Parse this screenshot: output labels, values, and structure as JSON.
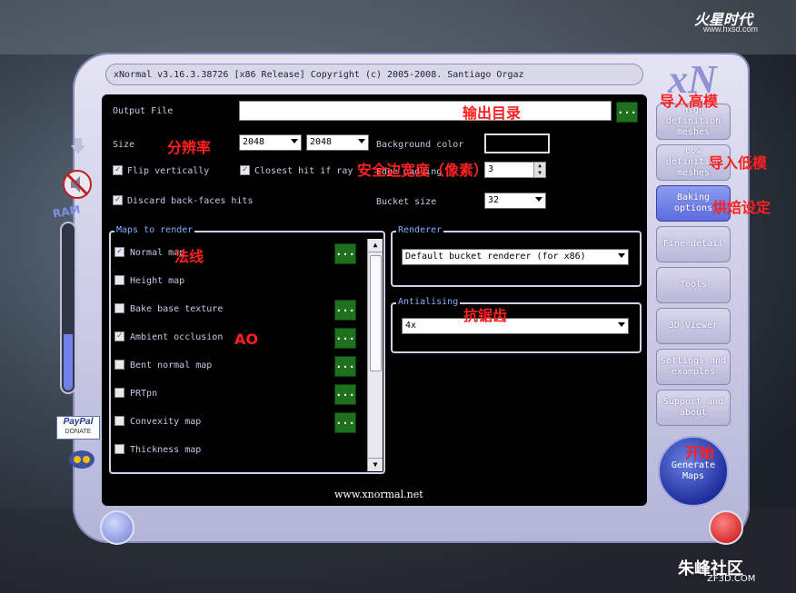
{
  "branding": {
    "logo": "火星时代",
    "url": "www.hxsd.com",
    "watermark_cn": "朱峰社区",
    "watermark_url": "ZF3D.COM"
  },
  "window": {
    "title": "xNormal v3.16.3.38726 [x86 Release] Copyright (c) 2005-2008. Santiago Orgaz",
    "logo": "xN"
  },
  "ram_label": "RAM",
  "ram_level": 0.33,
  "paypal": {
    "line1": "PayPal",
    "line2": "DONATE"
  },
  "output": {
    "label": "Output File",
    "value": "",
    "browse": "..."
  },
  "size": {
    "label": "Size",
    "width": "2048",
    "height": "2048"
  },
  "background_color": {
    "label": "Background color",
    "color": "#000000"
  },
  "flip_vertically": {
    "label": "Flip vertically",
    "checked": true
  },
  "closest_hit": {
    "label": "Closest hit if ray fails",
    "checked": true
  },
  "edge_padding": {
    "label": "Edge padding",
    "value": "3"
  },
  "discard_backfaces": {
    "label": "Discard back-faces hits",
    "checked": true
  },
  "bucket_size": {
    "label": "Bucket size",
    "value": "32"
  },
  "maps": {
    "title": "Maps to render",
    "items": [
      {
        "label": "Normal map",
        "checked": true,
        "btn": "..."
      },
      {
        "label": "Height map",
        "checked": false,
        "btn": ""
      },
      {
        "label": "Bake base texture",
        "checked": false,
        "btn": "..."
      },
      {
        "label": "Ambient occlusion",
        "checked": true,
        "btn": "..."
      },
      {
        "label": "Bent normal map",
        "checked": false,
        "btn": "..."
      },
      {
        "label": "PRTpn",
        "checked": false,
        "btn": "..."
      },
      {
        "label": "Convexity map",
        "checked": false,
        "btn": "..."
      },
      {
        "label": "Thickness map",
        "checked": false,
        "btn": ""
      }
    ]
  },
  "renderer": {
    "title": "Renderer",
    "value": "Default bucket renderer (for x86)"
  },
  "antialiasing": {
    "title": "Antialising",
    "value": "4x"
  },
  "footer_url": "www.xnormal.net",
  "sidebar": [
    {
      "label": "High definition meshes"
    },
    {
      "label": "Low definition meshes"
    },
    {
      "label": "Baking options"
    },
    {
      "label": "Fine detail"
    },
    {
      "label": "Tools"
    },
    {
      "label": "3D Viewer"
    },
    {
      "label": "Settings and examples"
    },
    {
      "label": "Support and about"
    }
  ],
  "generate": "Generate Maps",
  "annotations": {
    "output_dir": "输出目录",
    "import_high": "导入高模",
    "import_low": "导入低模",
    "resolution": "分辨率",
    "safe_margin": "安全边宽度（像素）",
    "bake_settings": "烘焙设定",
    "normal": "法线",
    "ao": "AO",
    "antialias": "抗锯齿",
    "start": "开始"
  }
}
